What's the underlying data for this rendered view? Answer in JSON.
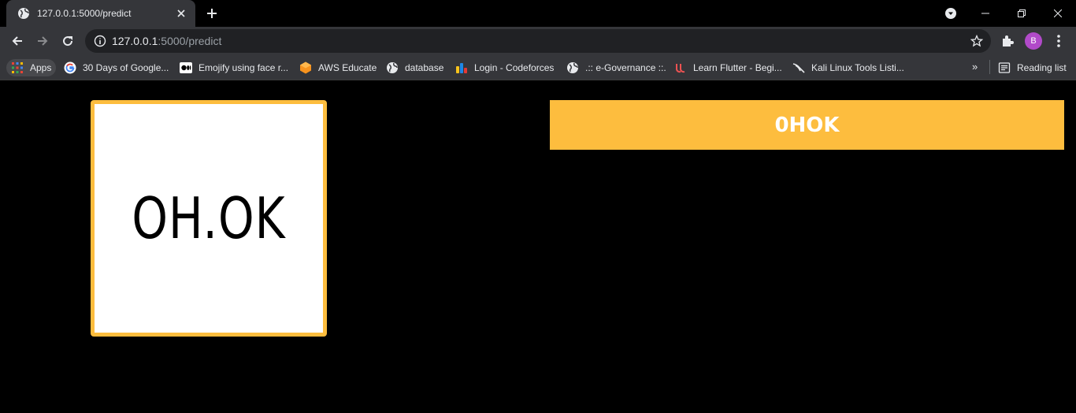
{
  "browser": {
    "tab": {
      "title": "127.0.0.1:5000/predict",
      "favicon": "globe-icon"
    },
    "address_bar": {
      "host": "127.0.0.1",
      "path": ":5000/predict"
    },
    "profile_initial": "B",
    "bookmarks": [
      {
        "label": "Apps",
        "icon": "apps-grid-icon"
      },
      {
        "label": "30 Days of Google...",
        "icon": "google-icon"
      },
      {
        "label": "Emojify using face r...",
        "icon": "medium-icon"
      },
      {
        "label": "AWS Educate",
        "icon": "aws-icon"
      },
      {
        "label": "database",
        "icon": "globe-icon"
      },
      {
        "label": "Login - Codeforces",
        "icon": "codeforces-icon"
      },
      {
        "label": ".:: e-Governance ::.",
        "icon": "globe-icon"
      },
      {
        "label": "Learn Flutter - Begi...",
        "icon": "udemy-icon"
      },
      {
        "label": "Kali Linux Tools Listi...",
        "icon": "kali-icon"
      }
    ],
    "bookmarks_overflow": "»",
    "reading_list": "Reading list"
  },
  "page": {
    "image_text": "OH.OK",
    "prediction": "0HOK",
    "accent_color": "#fdbd3e"
  }
}
